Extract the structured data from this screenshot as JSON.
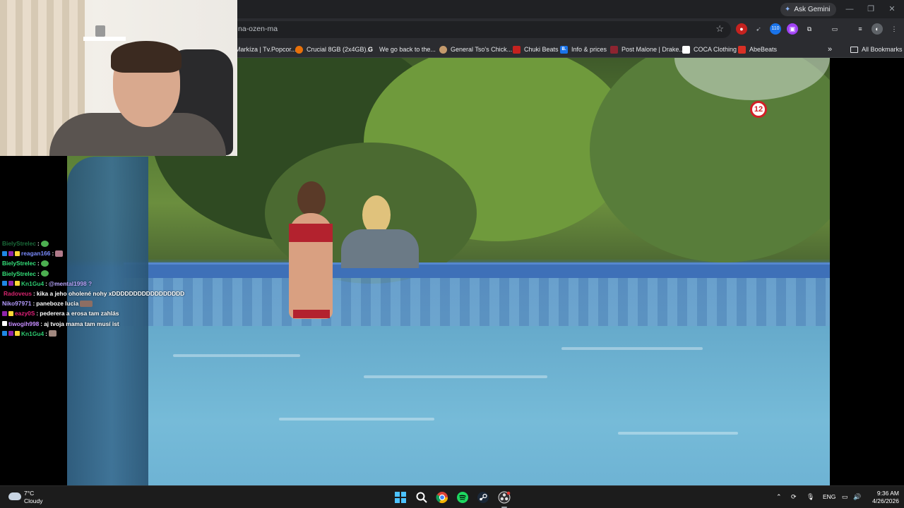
{
  "browser": {
    "ask_gemini_label": "Ask Gemini",
    "url": "na-ozen-ma",
    "extension_badge": "110",
    "bookmarks": [
      {
        "label": "Markíza | Tv.Popcor...",
        "color": "#2b2c30"
      },
      {
        "label": "Crucial 8GB (2x4GB)...",
        "color": "#e8710a"
      },
      {
        "label": "We go back to the...",
        "color": "#ffffff",
        "glyph": "G"
      },
      {
        "label": "General Tso's Chick...",
        "color": "#c49a6c"
      },
      {
        "label": "Chuki Beats",
        "color": "#c5221f"
      },
      {
        "label": "Info & prices",
        "color": "#1a73e8",
        "glyph": "B."
      },
      {
        "label": "Post Malone | Drake...",
        "color": "#8e2430"
      },
      {
        "label": "COCA Clothing",
        "color": "#ffffff"
      },
      {
        "label": "AbeBeats",
        "color": "#d93025"
      }
    ],
    "all_bookmarks_label": "All Bookmarks",
    "more_bookmarks_glyph": "»"
  },
  "video": {
    "age_rating": "12"
  },
  "chat": [
    {
      "user": "BielyStrelec",
      "user_color": "#1b6b3a",
      "message": "",
      "badges": [],
      "emote": "#4caf50"
    },
    {
      "user": "reagan166",
      "user_color": "#7b8cff",
      "message": "",
      "badges": [
        "#1e88e5",
        "#8e24aa",
        "#fdd835"
      ],
      "emote": "#b07a8a"
    },
    {
      "user": "BielyStrelec",
      "user_color": "#35e07a",
      "message": "",
      "badges": [],
      "emote": "#4caf50"
    },
    {
      "user": "BielyStrelec",
      "user_color": "#35e07a",
      "message": "",
      "badges": [],
      "emote": "#4caf50"
    },
    {
      "user": "Kn1Gu4",
      "user_color": "#2ecc71",
      "message": "@mental1998 ?",
      "message_color": "#b9a7ff",
      "badges": [
        "#1e88e5",
        "#8e24aa",
        "#fdd835"
      ]
    },
    {
      "user": "Radoveus",
      "user_color": "#d6246e",
      "message": "kika a jeho oholené nohy xDDDDDDDDDDDDDDDDD",
      "badges": [
        "#4dd0e1"
      ]
    },
    {
      "user": "Niko97971",
      "user_color": "#b59cff",
      "message": "paneboze lucia",
      "badges": [],
      "emote": "#8d6e63"
    },
    {
      "user": "eazy0S",
      "user_color": "#e0207a",
      "message": "pederera a erosa tam zahlás",
      "badges": [
        "#8e24aa",
        "#fdd835"
      ]
    },
    {
      "user": "tiwogih998",
      "user_color": "#c68cff",
      "message": "aj tvoja mama tam musí ist",
      "badges": [
        "#ffffff"
      ]
    },
    {
      "user": "Kn1Gu4",
      "user_color": "#2ecc71",
      "message": "",
      "badges": [
        "#1e88e5",
        "#8e24aa",
        "#fdd835"
      ],
      "emote": "#a1887f"
    }
  ],
  "taskbar": {
    "temperature": "7°C",
    "condition": "Cloudy",
    "language": "ENG",
    "time": "9:36 AM",
    "date": "4/26/2026"
  }
}
